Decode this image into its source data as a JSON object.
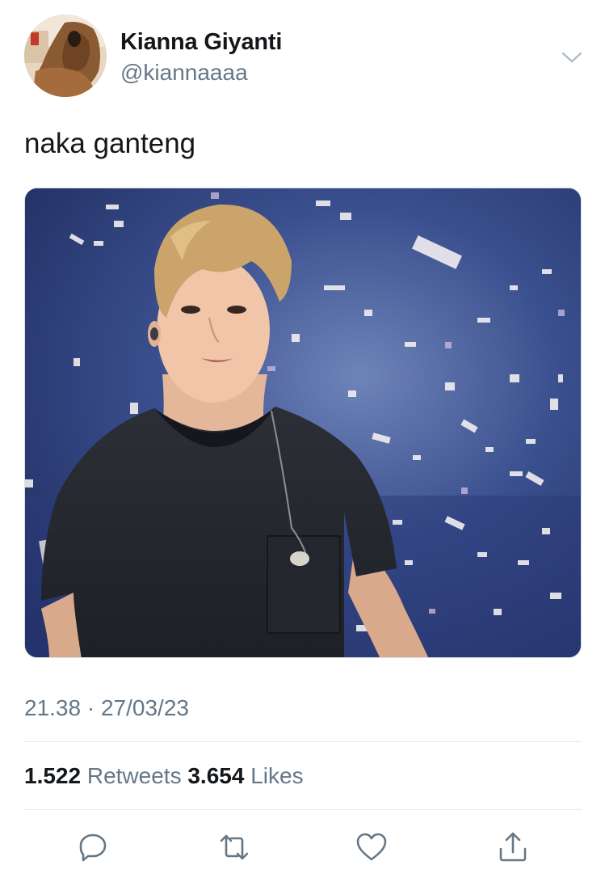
{
  "author": {
    "name": "Kianna Giyanti",
    "handle": "@kiannaaaa"
  },
  "tweet": {
    "text": "naka ganteng",
    "time": "21.38",
    "separator": "·",
    "date": "27/03/23"
  },
  "stats": {
    "retweets_count": "1.522",
    "retweets_label": "Retweets",
    "likes_count": "3.654",
    "likes_label": "Likes"
  },
  "icons": {
    "menu": "chevron-down-icon",
    "reply": "reply-icon",
    "retweet": "retweet-icon",
    "like": "heart-icon",
    "share": "share-icon"
  },
  "colors": {
    "text_primary": "#14171a",
    "text_secondary": "#657786",
    "divider": "#e1e8ed",
    "icon": "#657786"
  }
}
